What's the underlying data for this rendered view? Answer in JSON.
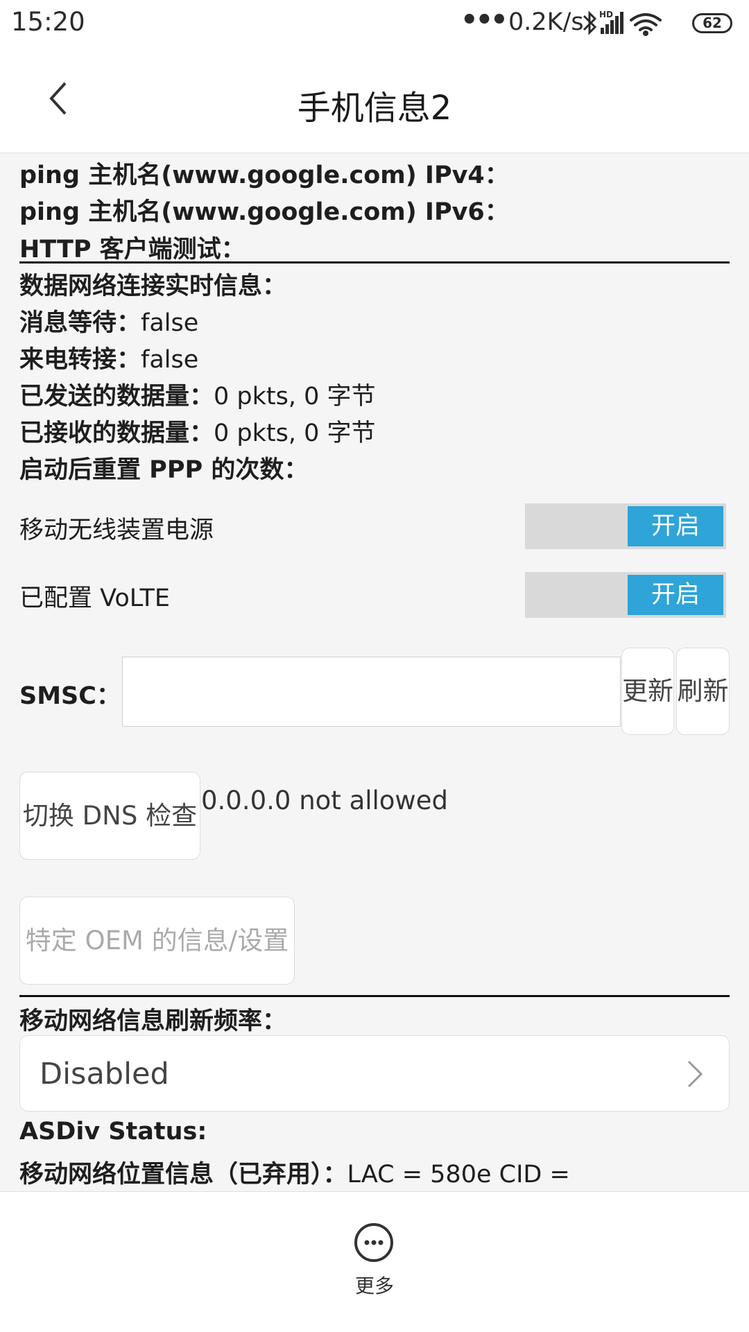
{
  "status_bar": {
    "time": "15:20",
    "dots": "•••",
    "speed": "0.2K/s",
    "hd_label": "HD",
    "battery": "62",
    "icons": [
      "bluetooth-icon",
      "signal-icon",
      "wifi-icon",
      "battery-icon"
    ]
  },
  "app_bar": {
    "title": "手机信息2",
    "back_icon": "chevron-left-icon"
  },
  "info_rows": {
    "ping_ipv4_label": "ping 主机名(www.google.com) IPv4：",
    "ping_ipv6_label": "ping 主机名(www.google.com) IPv6：",
    "http_test_label": "HTTP 客户端测试：",
    "data_realtime_label": "数据网络连接实时信息：",
    "msg_waiting_label": "消息等待：",
    "msg_waiting_value": "false",
    "call_forward_label": "来电转接：",
    "call_forward_value": "false",
    "sent_label": "已发送的数据量：",
    "sent_value": "0 pkts, 0 字节",
    "received_label": "已接收的数据量：",
    "received_value": "0 pkts, 0 字节",
    "ppp_reset_label": "启动后重置 PPP 的次数："
  },
  "toggles": {
    "radio_power_label": "移动无线装置电源",
    "radio_power_state": "开启",
    "volte_label": "已配置 VoLTE",
    "volte_state": "开启"
  },
  "smsc": {
    "label": "SMSC：",
    "value": "",
    "update_button": "更新",
    "refresh_button": "刷新"
  },
  "dns": {
    "button": "切换 DNS 检查",
    "status": "0.0.0.0 not allowed"
  },
  "oem": {
    "button": "特定 OEM 的信息/设置"
  },
  "refresh_rate": {
    "label": "移动网络信息刷新频率：",
    "selected": "Disabled"
  },
  "asdiv": {
    "label": "ASDiv Status:"
  },
  "cell_location": {
    "label": "移动网络位置信息（已弃用）：",
    "value": "LAC = 580e   CID ="
  },
  "bottom_bar": {
    "more_label": "更多",
    "more_icon": "more-horizontal-icon"
  },
  "colors": {
    "toggle_on": "#2ea4d8",
    "toggle_track": "#d9d9d9",
    "background": "#f5f5f5",
    "bar": "#ffffff"
  }
}
